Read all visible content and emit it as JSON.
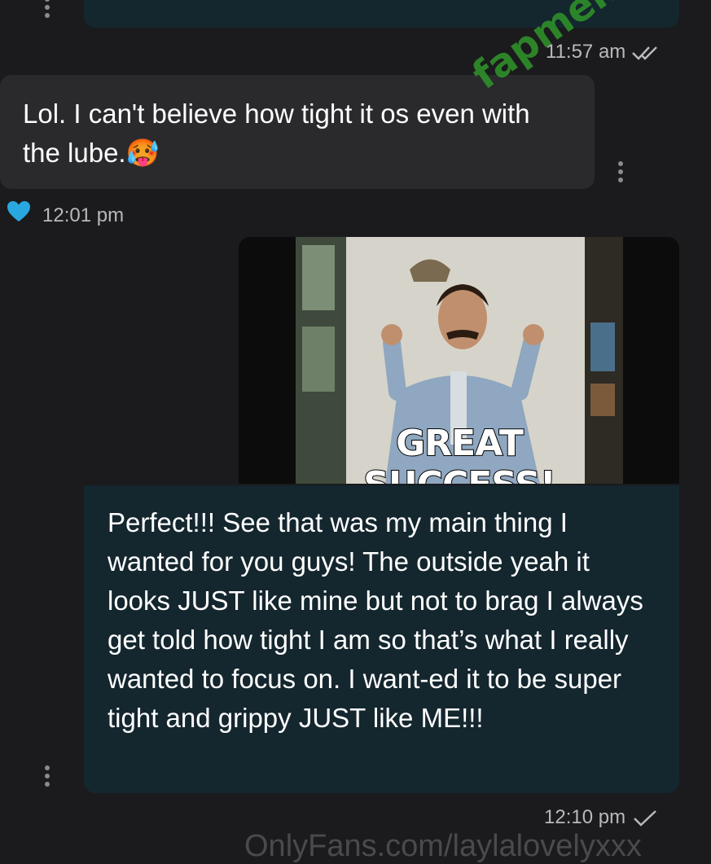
{
  "messages": [
    {
      "id": "m1",
      "direction": "sent",
      "text": "",
      "time": "11:57 am",
      "status": "read"
    },
    {
      "id": "m2",
      "direction": "received",
      "text": "Lol. I can't believe how tight it os even with the lube.🥵",
      "time": "12:01 pm",
      "liked": true
    },
    {
      "id": "m3",
      "direction": "sent",
      "media_caption": "GREAT SUCCESS!",
      "text": "Perfect!!! See that was my main thing I wanted for you guys! The outside yeah it looks JUST like mine but not to brag I always get told how tight I am so that’s what I really wanted to focus on. I want-ed it to be super tight and grippy JUST like ME!!!",
      "time": "12:10 pm",
      "status": "sent"
    }
  ],
  "watermarks": {
    "site": "fapmenu.com",
    "footer": "OnlyFans.com/laylalovelyxxx"
  },
  "colors": {
    "background": "#1b1b1d",
    "sent_bubble": "#14262e",
    "received_bubble": "#2a2a2d",
    "heart": "#29a8e0",
    "watermark": "#2f8f2a"
  },
  "icons": [
    "more-vert-icon",
    "double-check-icon",
    "heart-icon",
    "single-check-icon"
  ]
}
